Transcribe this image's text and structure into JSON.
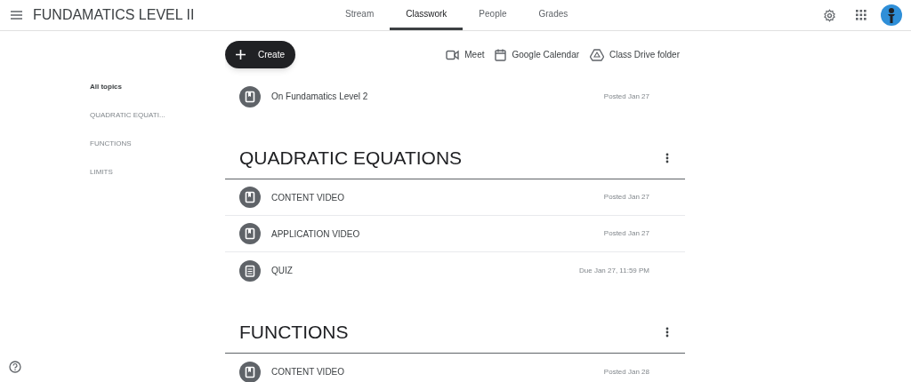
{
  "header": {
    "title": "FUNDAMATICS LEVEL II",
    "tabs": [
      {
        "label": "Stream",
        "selected": false
      },
      {
        "label": "Classwork",
        "selected": true
      },
      {
        "label": "People",
        "selected": false
      },
      {
        "label": "Grades",
        "selected": false
      }
    ]
  },
  "toolbar": {
    "create": "Create",
    "links": [
      {
        "kind": "meet",
        "label": "Meet"
      },
      {
        "kind": "calendar",
        "label": "Google Calendar"
      },
      {
        "kind": "drive",
        "label": "Class Drive folder"
      }
    ]
  },
  "sidebar": {
    "items": [
      {
        "label": "All topics",
        "selected": true
      },
      {
        "label": "QUADRATIC EQUATI...",
        "selected": false
      },
      {
        "label": "FUNCTIONS",
        "selected": false
      },
      {
        "label": "LIMITS",
        "selected": false
      }
    ]
  },
  "loose_items": [
    {
      "kind": "material",
      "title": "On Fundamatics Level 2",
      "date": "Posted Jan 27"
    }
  ],
  "topics": [
    {
      "title": "QUADRATIC EQUATIONS",
      "items": [
        {
          "kind": "material",
          "title": "CONTENT VIDEO",
          "date": "Posted Jan 27"
        },
        {
          "kind": "material",
          "title": "APPLICATION VIDEO",
          "date": "Posted Jan 27"
        },
        {
          "kind": "assignment",
          "title": "QUIZ",
          "date": "Due Jan 27, 11:59 PM"
        }
      ]
    },
    {
      "title": "FUNCTIONS",
      "items": [
        {
          "kind": "material",
          "title": "CONTENT VIDEO",
          "date": "Posted Jan 28"
        }
      ]
    }
  ]
}
